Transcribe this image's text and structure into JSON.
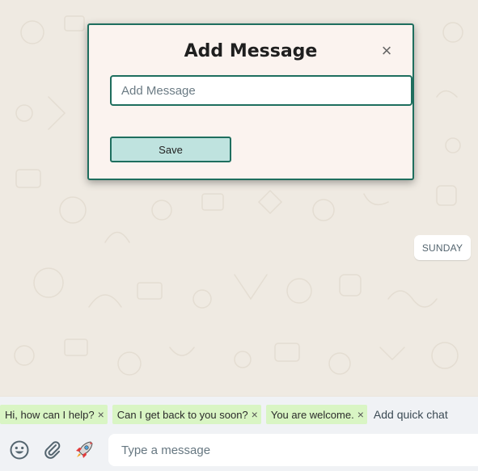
{
  "modal": {
    "title": "Add Message",
    "close_symbol": "×",
    "input_placeholder": "Add Message",
    "input_value": "",
    "save_label": "Save"
  },
  "chat": {
    "date_chip": "SUNDAY"
  },
  "quick_chats": {
    "items": [
      {
        "label": "Hi, how can I help?",
        "remove": "×"
      },
      {
        "label": "Can I get back to you soon?",
        "remove": "×"
      },
      {
        "label": "You are welcome.",
        "remove": "×"
      }
    ],
    "add_label": "Add quick chat"
  },
  "composer": {
    "placeholder": "Type a message",
    "icons": [
      "emoji-icon",
      "paperclip-icon",
      "rocket-icon"
    ]
  },
  "colors": {
    "accent": "#1e6e5e",
    "modal_bg": "#fbf3ef",
    "save_bg": "#bfe3df",
    "chip_bg": "#d9f5c4",
    "wallpaper": "#efeae2"
  }
}
